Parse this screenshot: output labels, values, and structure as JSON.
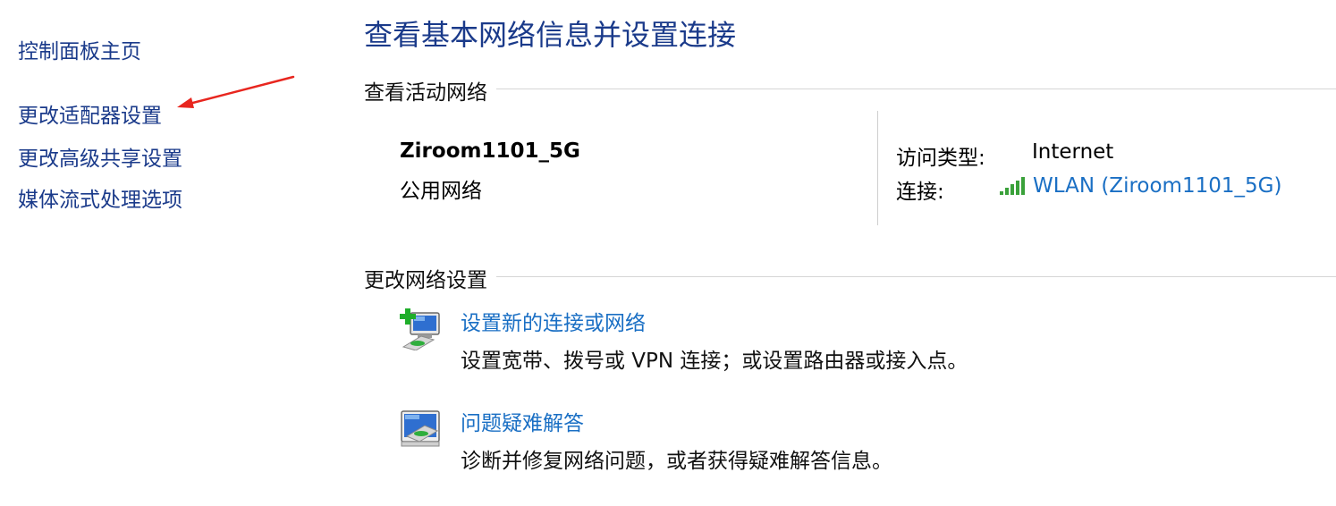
{
  "sidebar": {
    "home": "控制面板主页",
    "adapter_settings": "更改适配器设置",
    "advanced_sharing": "更改高级共享设置",
    "media_streaming": "媒体流式处理选项"
  },
  "main": {
    "title": "查看基本网络信息并设置连接",
    "active_section": {
      "heading": "查看活动网络",
      "network_name": "Ziroom1101_5G",
      "network_type": "公用网络",
      "access_type_label": "访问类型:",
      "access_type_value": "Internet",
      "connection_label": "连接:",
      "connection_value": "WLAN (Ziroom1101_5G)"
    },
    "change_section": {
      "heading": "更改网络设置",
      "tasks": [
        {
          "link": "设置新的连接或网络",
          "description": "设置宽带、拨号或 VPN 连接；或设置路由器或接入点。",
          "icon": "new-connection-icon"
        },
        {
          "link": "问题疑难解答",
          "description": "诊断并修复网络问题，或者获得疑难解答信息。",
          "icon": "troubleshoot-icon"
        }
      ]
    }
  },
  "colors": {
    "link": "#1a6fc4",
    "title": "#1a3a8a",
    "annotation_arrow": "#e8261f",
    "signal": "#3aa13a"
  }
}
